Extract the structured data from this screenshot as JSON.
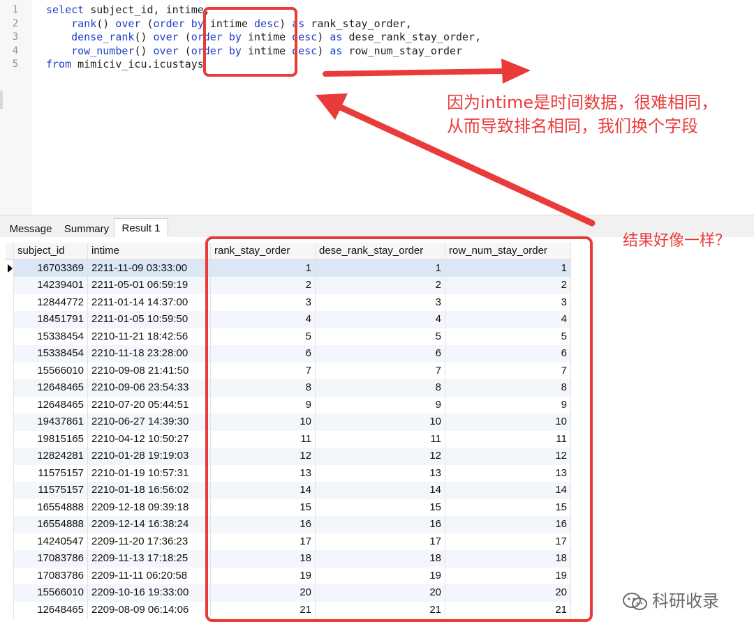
{
  "editor": {
    "lines": [
      {
        "n": "1",
        "tokens": [
          {
            "t": "select",
            "k": "kw"
          },
          {
            "t": " subject_id, intime,",
            "k": "id"
          }
        ]
      },
      {
        "n": "2",
        "tokens": [
          {
            "t": "    rank",
            "k": "kw"
          },
          {
            "t": "() ",
            "k": "id"
          },
          {
            "t": "over",
            "k": "kw"
          },
          {
            "t": " (",
            "k": "id"
          },
          {
            "t": "order",
            "k": "kw"
          },
          {
            "t": " ",
            "k": "id"
          },
          {
            "t": "by",
            "k": "kw"
          },
          {
            "t": " intime ",
            "k": "id"
          },
          {
            "t": "desc",
            "k": "kw"
          },
          {
            "t": ") ",
            "k": "id"
          },
          {
            "t": "as",
            "k": "kw"
          },
          {
            "t": " rank_stay_order,",
            "k": "id"
          }
        ]
      },
      {
        "n": "3",
        "tokens": [
          {
            "t": "    dense_rank",
            "k": "kw"
          },
          {
            "t": "() ",
            "k": "id"
          },
          {
            "t": "over",
            "k": "kw"
          },
          {
            "t": " (",
            "k": "id"
          },
          {
            "t": "order",
            "k": "kw"
          },
          {
            "t": " ",
            "k": "id"
          },
          {
            "t": "by",
            "k": "kw"
          },
          {
            "t": " intime ",
            "k": "id"
          },
          {
            "t": "desc",
            "k": "kw"
          },
          {
            "t": ") ",
            "k": "id"
          },
          {
            "t": "as",
            "k": "kw"
          },
          {
            "t": " dese_rank_stay_order,",
            "k": "id"
          }
        ]
      },
      {
        "n": "4",
        "tokens": [
          {
            "t": "    row_number",
            "k": "kw"
          },
          {
            "t": "() ",
            "k": "id"
          },
          {
            "t": "over",
            "k": "kw"
          },
          {
            "t": " (",
            "k": "id"
          },
          {
            "t": "order",
            "k": "kw"
          },
          {
            "t": " ",
            "k": "id"
          },
          {
            "t": "by",
            "k": "kw"
          },
          {
            "t": " intime ",
            "k": "id"
          },
          {
            "t": "desc",
            "k": "kw"
          },
          {
            "t": ") ",
            "k": "id"
          },
          {
            "t": "as",
            "k": "kw"
          },
          {
            "t": " row_num_stay_order",
            "k": "id"
          }
        ]
      },
      {
        "n": "5",
        "tokens": [
          {
            "t": "from",
            "k": "kw"
          },
          {
            "t": " mimiciv_icu.icustays",
            "k": "id"
          }
        ]
      }
    ]
  },
  "tabs": [
    {
      "label": "Message",
      "active": false
    },
    {
      "label": "Summary",
      "active": false
    },
    {
      "label": "Result 1",
      "active": true
    }
  ],
  "grid": {
    "columns": [
      "subject_id",
      "intime",
      "rank_stay_order",
      "dese_rank_stay_order",
      "row_num_stay_order"
    ],
    "rows": [
      [
        "16703369",
        "2211-11-09 03:33:00",
        "1",
        "1",
        "1"
      ],
      [
        "14239401",
        "2211-05-01 06:59:19",
        "2",
        "2",
        "2"
      ],
      [
        "12844772",
        "2211-01-14 14:37:00",
        "3",
        "3",
        "3"
      ],
      [
        "18451791",
        "2211-01-05 10:59:50",
        "4",
        "4",
        "4"
      ],
      [
        "15338454",
        "2210-11-21 18:42:56",
        "5",
        "5",
        "5"
      ],
      [
        "15338454",
        "2210-11-18 23:28:00",
        "6",
        "6",
        "6"
      ],
      [
        "15566010",
        "2210-09-08 21:41:50",
        "7",
        "7",
        "7"
      ],
      [
        "12648465",
        "2210-09-06 23:54:33",
        "8",
        "8",
        "8"
      ],
      [
        "12648465",
        "2210-07-20 05:44:51",
        "9",
        "9",
        "9"
      ],
      [
        "19437861",
        "2210-06-27 14:39:30",
        "10",
        "10",
        "10"
      ],
      [
        "19815165",
        "2210-04-12 10:50:27",
        "11",
        "11",
        "11"
      ],
      [
        "12824281",
        "2210-01-28 19:19:03",
        "12",
        "12",
        "12"
      ],
      [
        "11575157",
        "2210-01-19 10:57:31",
        "13",
        "13",
        "13"
      ],
      [
        "11575157",
        "2210-01-18 16:56:02",
        "14",
        "14",
        "14"
      ],
      [
        "16554888",
        "2209-12-18 09:39:18",
        "15",
        "15",
        "15"
      ],
      [
        "16554888",
        "2209-12-14 16:38:24",
        "16",
        "16",
        "16"
      ],
      [
        "14240547",
        "2209-11-20 17:36:23",
        "17",
        "17",
        "17"
      ],
      [
        "17083786",
        "2209-11-13 17:18:25",
        "18",
        "18",
        "18"
      ],
      [
        "17083786",
        "2209-11-11 06:20:58",
        "19",
        "19",
        "19"
      ],
      [
        "15566010",
        "2209-10-16 19:33:00",
        "20",
        "20",
        "20"
      ],
      [
        "12648465",
        "2209-08-09 06:14:06",
        "21",
        "21",
        "21"
      ]
    ],
    "selected_row": 0
  },
  "annotations": {
    "note1_line1": "因为intime是时间数据，很难相同，",
    "note1_line2": "从而导致排名相同，我们换个字段",
    "note2": "结果好像一样？",
    "color": "#ea3b3b"
  },
  "watermark": {
    "text": "科研收录",
    "icon": "wechat-icon"
  }
}
